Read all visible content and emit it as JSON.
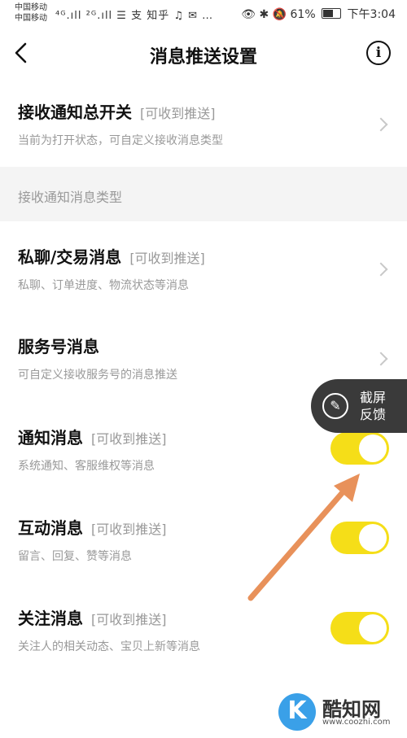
{
  "status_bar": {
    "carrier1": "中国移动",
    "carrier2": "中国移动",
    "left_icons": "⁴ᴳ.ıll ²ᴳ.ıll ☰ 支 知乎 ♫ ✉ …",
    "right_text": "👁 ✱ 🔕 61%",
    "time": "下午3:04"
  },
  "header": {
    "title": "消息推送设置",
    "back_icon": "chevron-left-icon",
    "info_icon": "info-icon"
  },
  "master": {
    "title": "接收通知总开关",
    "status": "[可收到推送]",
    "desc": "当前为打开状态，可自定义接收消息类型"
  },
  "section_label": "接收通知消息类型",
  "items": [
    {
      "title": "私聊/交易消息",
      "status": "[可收到推送]",
      "desc": "私聊、订单进度、物流状态等消息",
      "control": "chevron"
    },
    {
      "title": "服务号消息",
      "status": "",
      "desc": "可自定义接收服务号的消息推送",
      "control": "chevron"
    },
    {
      "title": "通知消息",
      "status": "[可收到推送]",
      "desc": "系统通知、客服维权等消息",
      "control": "toggle",
      "on": true
    },
    {
      "title": "互动消息",
      "status": "[可收到推送]",
      "desc": "留言、回复、赞等消息",
      "control": "toggle",
      "on": true
    },
    {
      "title": "关注消息",
      "status": "[可收到推送]",
      "desc": "关注人的相关动态、宝贝上新等消息",
      "control": "toggle",
      "on": true
    }
  ],
  "feedback": {
    "line1": "截屏",
    "line2": "反馈"
  },
  "watermark": {
    "logo": "K",
    "name": "酷知网",
    "url": "www.coozhi.com"
  },
  "colors": {
    "toggle_on": "#f5de18",
    "arrow": "#e8915a",
    "section_bg": "#f4f4f4"
  }
}
